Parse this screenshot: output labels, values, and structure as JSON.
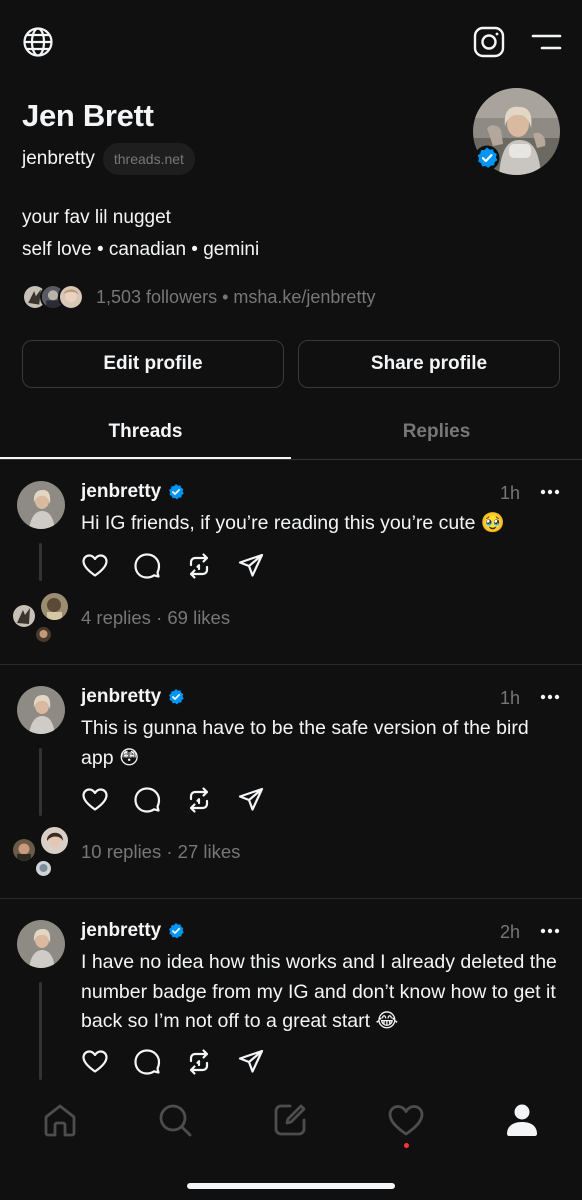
{
  "profile": {
    "name": "Jen Brett",
    "handle": "jenbretty",
    "domain": "threads.net",
    "bio_line1": "your fav lil nugget",
    "bio_line2": "self love • canadian • gemini",
    "followers_text": "1,503 followers • msha.ke/jenbretty"
  },
  "buttons": {
    "edit": "Edit profile",
    "share": "Share profile"
  },
  "tabs": {
    "threads": "Threads",
    "replies": "Replies"
  },
  "posts": [
    {
      "username": "jenbretty",
      "time": "1h",
      "text": "Hi IG friends, if you’re reading this you’re cute 🥹",
      "stats": "4 replies · 69 likes"
    },
    {
      "username": "jenbretty",
      "time": "1h",
      "text": "This is gunna have to be the safe version of the bird app 😳",
      "stats": "10 replies · 27 likes"
    },
    {
      "username": "jenbretty",
      "time": "2h",
      "text": "I have no idea how this works and I already deleted the number badge from my IG and don’t know how to get it back so I’m not off to a great start 😂",
      "stats": ""
    }
  ],
  "icons": {
    "top_left": "globe-icon",
    "top_right_1": "instagram-icon",
    "top_right_2": "menu-icon",
    "nav": [
      "home-icon",
      "search-icon",
      "compose-icon",
      "heart-icon",
      "profile-icon"
    ]
  },
  "colors": {
    "background": "#101010",
    "text": "#f3f5f7",
    "muted": "#777777",
    "verified": "#0095f6",
    "notification": "#ff3040"
  }
}
